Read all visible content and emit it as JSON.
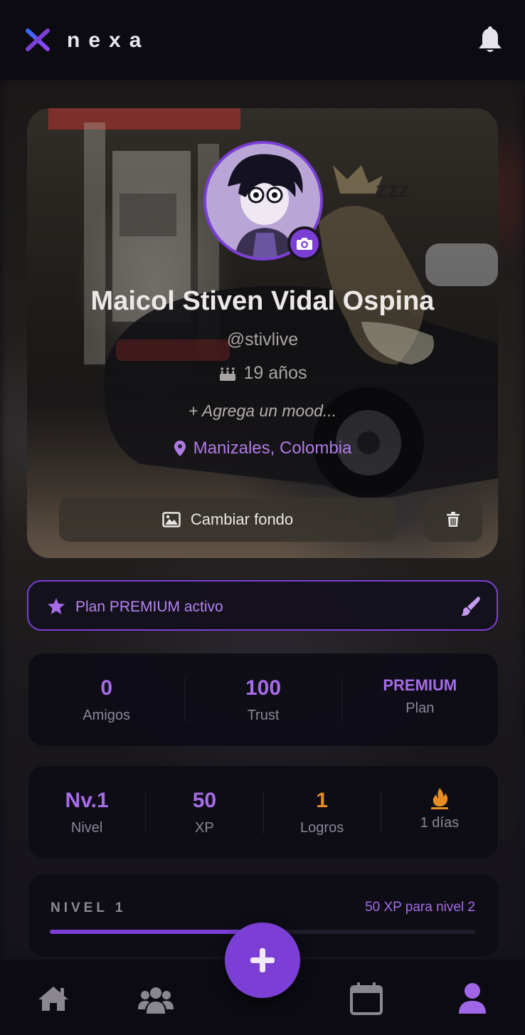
{
  "app": {
    "name": "nexa",
    "accent_color": "#7b3fd6",
    "logo_icon": "x-logo-icon",
    "notifications_icon": "bell-icon"
  },
  "profile": {
    "name": "Maicol Stiven Vidal Ospina",
    "handle": "@stivlive",
    "age": "19 años",
    "age_icon": "birthday-cake-icon",
    "mood_placeholder": "+ Agrega un mood...",
    "location": "Manizales, Colombia",
    "location_icon": "map-pin-icon",
    "avatar_edit_icon": "camera-icon",
    "change_background_label": "Cambiar fondo",
    "change_background_icon": "image-icon",
    "delete_background_icon": "trash-icon"
  },
  "premium_banner": {
    "label": "Plan PREMIUM activo",
    "icon": "star-icon",
    "action_icon": "paint-brush-icon"
  },
  "stats": [
    {
      "value": "0",
      "label": "Amigos"
    },
    {
      "value": "100",
      "label": "Trust"
    },
    {
      "value": "PREMIUM",
      "label": "Plan"
    }
  ],
  "progress_stats": [
    {
      "value": "Nv.1",
      "label": "Nivel"
    },
    {
      "value": "50",
      "label": "XP"
    },
    {
      "value": "1",
      "label": "Logros"
    },
    {
      "icon": "flame-icon",
      "label": "1 días"
    }
  ],
  "level": {
    "title": "NIVEL 1",
    "next_label": "50 XP para nivel 2",
    "progress_fraction": 0.5
  },
  "bottom_nav": {
    "items": [
      "home-icon",
      "users-icon",
      "calendar-icon",
      "user-icon"
    ],
    "active": "user-icon",
    "fab_icon": "plus-icon"
  }
}
